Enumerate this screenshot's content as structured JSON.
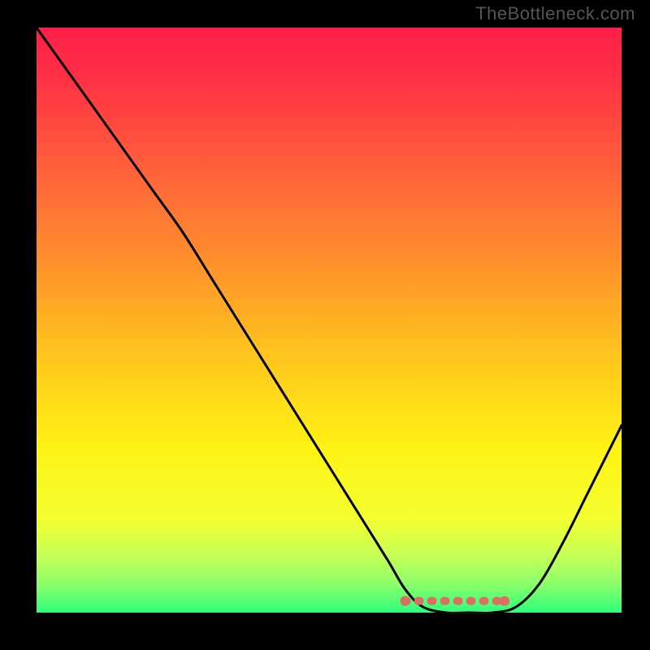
{
  "watermark": "TheBottleneck.com",
  "chart_data": {
    "type": "line",
    "title": "",
    "xlabel": "",
    "ylabel": "",
    "xlim": [
      0,
      100
    ],
    "ylim": [
      0,
      100
    ],
    "x": [
      0,
      5,
      10,
      15,
      20,
      25,
      30,
      35,
      40,
      45,
      50,
      55,
      60,
      63,
      66,
      70,
      74,
      78,
      82,
      86,
      90,
      94,
      98,
      100
    ],
    "values": [
      100,
      93,
      86,
      79,
      72,
      65,
      57,
      49,
      41,
      33,
      25,
      17,
      9,
      4,
      1,
      0,
      0,
      0,
      1,
      5,
      12,
      20,
      28,
      32
    ],
    "highlight_band": {
      "x0": 63,
      "x1": 80,
      "y": 2
    },
    "background_gradient": {
      "stops": [
        {
          "offset": 0.0,
          "color": "#ff1f4a"
        },
        {
          "offset": 0.08,
          "color": "#ff2e44"
        },
        {
          "offset": 0.22,
          "color": "#ff5a3d"
        },
        {
          "offset": 0.38,
          "color": "#ff8a2e"
        },
        {
          "offset": 0.55,
          "color": "#ffc21e"
        },
        {
          "offset": 0.72,
          "color": "#fff314"
        },
        {
          "offset": 0.84,
          "color": "#f3ff30"
        },
        {
          "offset": 0.9,
          "color": "#c8ff55"
        },
        {
          "offset": 0.95,
          "color": "#8dff6a"
        },
        {
          "offset": 1.0,
          "color": "#2dff7a"
        }
      ]
    },
    "curve_color": "#000000",
    "highlight_color": "#e06a64"
  }
}
